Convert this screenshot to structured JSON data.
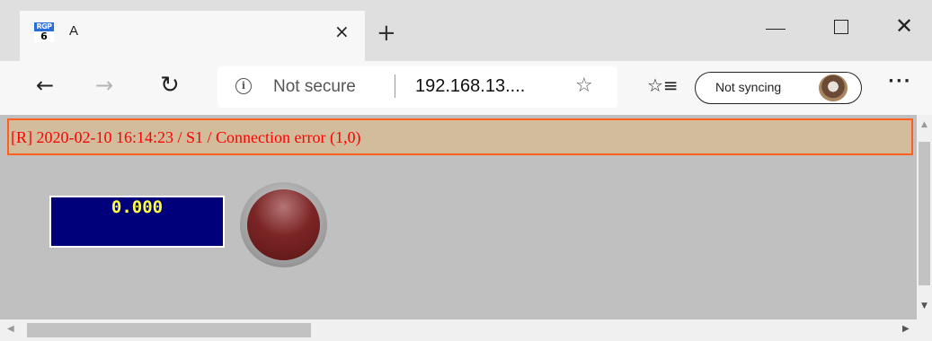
{
  "browser": {
    "tab": {
      "favicon_top": "RGP",
      "favicon_bottom": "6",
      "title": "A",
      "close_glyph": "×"
    },
    "new_tab_glyph": "+",
    "window_controls": {
      "close_glyph": "✕"
    },
    "toolbar": {
      "back_glyph": "←",
      "forward_glyph": "→",
      "reload_glyph": "↻",
      "info_glyph": "i",
      "security_text": "Not secure",
      "url": "192.168.13....",
      "star_glyph": "☆",
      "favorites_glyph": "☆≡",
      "sync_label": "Not syncing",
      "more_glyph": "···"
    }
  },
  "page": {
    "status_message": "[R] 2020-02-10 16:14:23 / S1 / Connection error (1,0)",
    "display_value": "0.000",
    "indicator": {
      "state": "off",
      "color": "#7c2626"
    },
    "colors": {
      "background": "#c0c0c0",
      "status_bg": "#d2bc9c",
      "status_border": "#ff6020",
      "status_text": "#ff0000",
      "display_bg": "#00007a",
      "display_text": "#ffff3c"
    }
  },
  "scrollbars": {
    "up_glyph": "▲",
    "down_glyph": "▼",
    "left_glyph": "◀",
    "right_glyph": "▶"
  }
}
